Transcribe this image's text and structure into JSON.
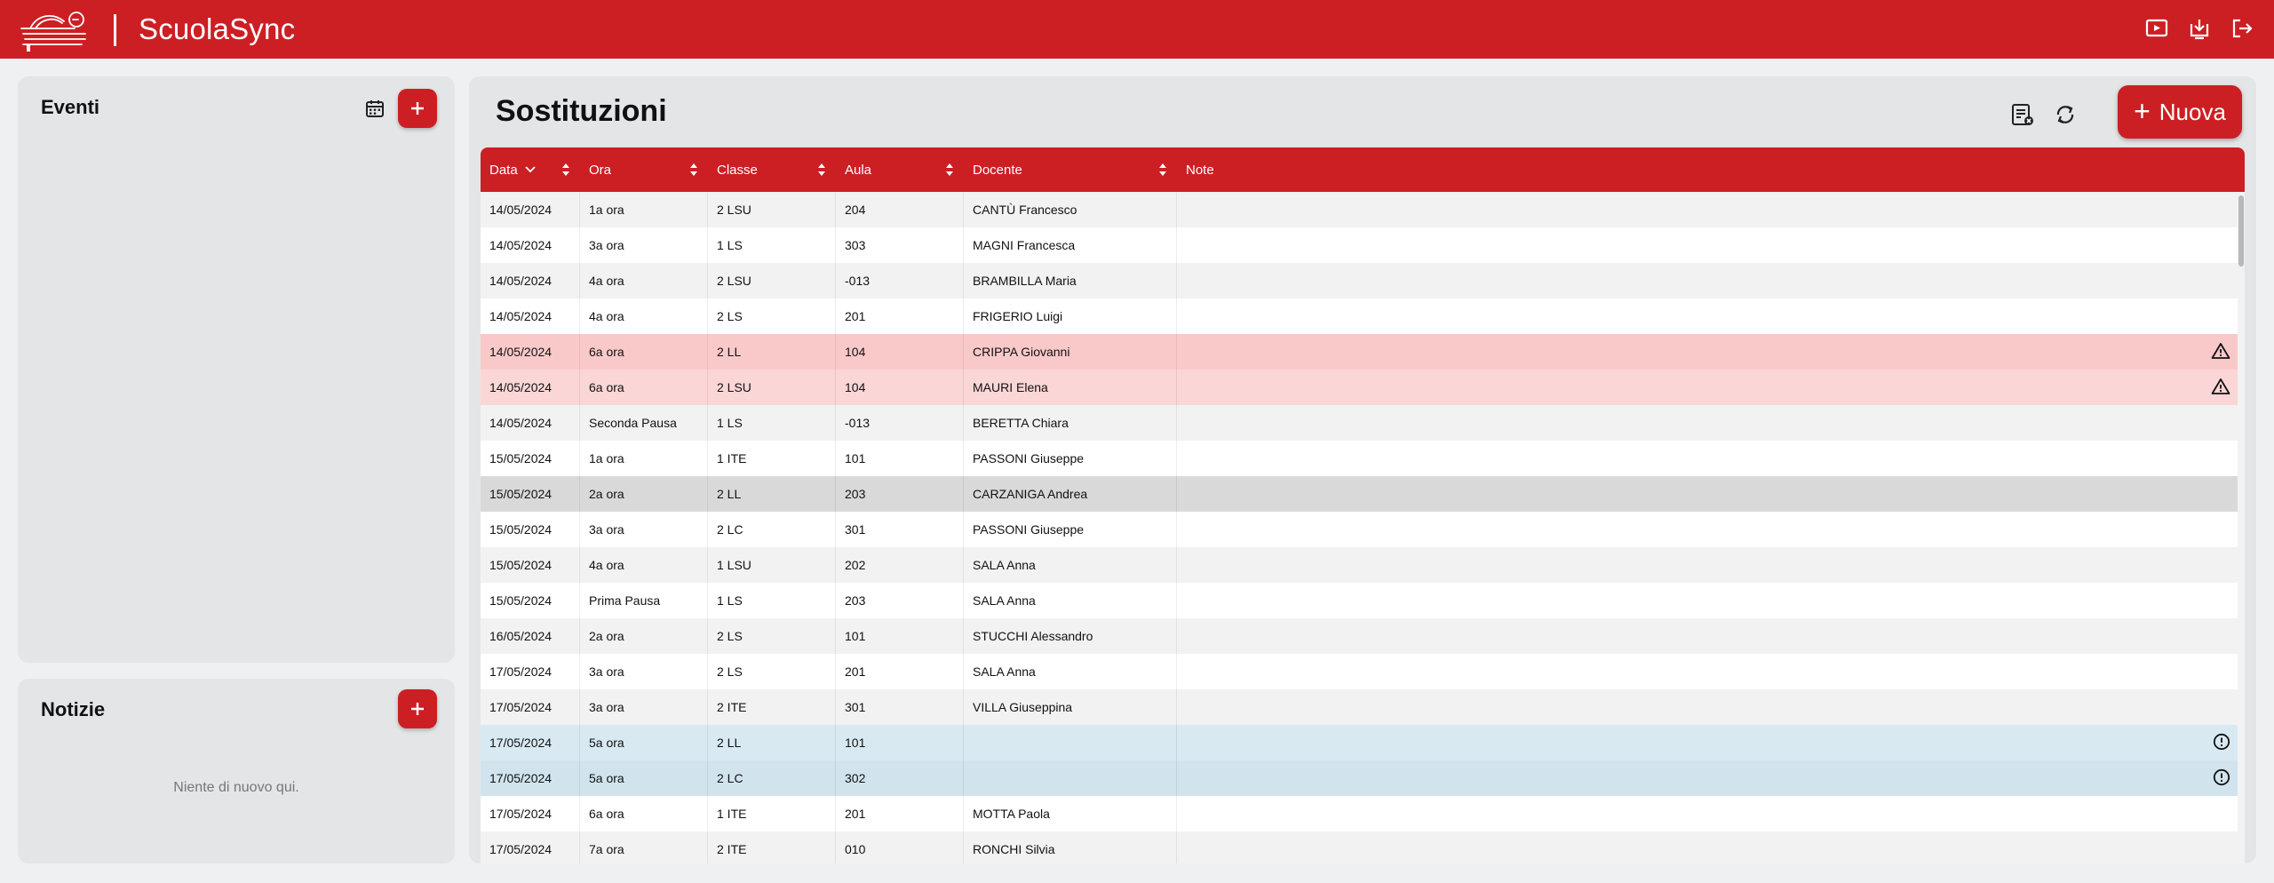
{
  "app": {
    "name": "ScuolaSync"
  },
  "header": {
    "icons": [
      "presentation-icon",
      "download-icon",
      "logout-icon"
    ]
  },
  "events": {
    "title": "Eventi",
    "add_label": "+"
  },
  "news": {
    "title": "Notizie",
    "add_label": "+",
    "empty_text": "Niente di nuovo qui."
  },
  "main": {
    "title": "Sostituzioni",
    "new_label": "Nuova",
    "new_plus": "+",
    "columns": [
      "Data",
      "Ora",
      "Classe",
      "Aula",
      "Docente",
      "Note"
    ],
    "rows": [
      {
        "date": "14/05/2024",
        "ora": "1a ora",
        "classe": "2 LSU",
        "aula": "204",
        "docente": "CANTÙ Francesco",
        "note": "",
        "status": "normal"
      },
      {
        "date": "14/05/2024",
        "ora": "3a ora",
        "classe": "1 LS",
        "aula": "303",
        "docente": "MAGNI Francesca",
        "note": "",
        "status": "normal"
      },
      {
        "date": "14/05/2024",
        "ora": "4a ora",
        "classe": "2 LSU",
        "aula": "-013",
        "docente": "BRAMBILLA Maria",
        "note": "",
        "status": "normal"
      },
      {
        "date": "14/05/2024",
        "ora": "4a ora",
        "classe": "2 LS",
        "aula": "201",
        "docente": "FRIGERIO Luigi",
        "note": "",
        "status": "normal"
      },
      {
        "date": "14/05/2024",
        "ora": "6a ora",
        "classe": "2 LL",
        "aula": "104",
        "docente": "CRIPPA Giovanni",
        "note": "",
        "status": "warning"
      },
      {
        "date": "14/05/2024",
        "ora": "6a ora",
        "classe": "2 LSU",
        "aula": "104",
        "docente": "MAURI Elena",
        "note": "",
        "status": "warning"
      },
      {
        "date": "14/05/2024",
        "ora": "Seconda Pausa",
        "classe": "1 LS",
        "aula": "-013",
        "docente": "BERETTA Chiara",
        "note": "",
        "status": "normal"
      },
      {
        "date": "15/05/2024",
        "ora": "1a ora",
        "classe": "1 ITE",
        "aula": "101",
        "docente": "PASSONI Giuseppe",
        "note": "",
        "status": "normal"
      },
      {
        "date": "15/05/2024",
        "ora": "2a ora",
        "classe": "2 LL",
        "aula": "203",
        "docente": "CARZANIGA Andrea",
        "note": "",
        "status": "selected"
      },
      {
        "date": "15/05/2024",
        "ora": "3a ora",
        "classe": "2 LC",
        "aula": "301",
        "docente": "PASSONI Giuseppe",
        "note": "",
        "status": "normal"
      },
      {
        "date": "15/05/2024",
        "ora": "4a ora",
        "classe": "1 LSU",
        "aula": "202",
        "docente": "SALA Anna",
        "note": "",
        "status": "normal"
      },
      {
        "date": "15/05/2024",
        "ora": "Prima Pausa",
        "classe": "1 LS",
        "aula": "203",
        "docente": "SALA Anna",
        "note": "",
        "status": "normal"
      },
      {
        "date": "16/05/2024",
        "ora": "2a ora",
        "classe": "2 LS",
        "aula": "101",
        "docente": "STUCCHI Alessandro",
        "note": "",
        "status": "normal"
      },
      {
        "date": "17/05/2024",
        "ora": "3a ora",
        "classe": "2 LS",
        "aula": "201",
        "docente": "SALA Anna",
        "note": "",
        "status": "normal"
      },
      {
        "date": "17/05/2024",
        "ora": "3a ora",
        "classe": "2 ITE",
        "aula": "301",
        "docente": "VILLA Giuseppina",
        "note": "",
        "status": "normal"
      },
      {
        "date": "17/05/2024",
        "ora": "5a ora",
        "classe": "2 LL",
        "aula": "101",
        "docente": "",
        "note": "",
        "status": "info"
      },
      {
        "date": "17/05/2024",
        "ora": "5a ora",
        "classe": "2 LC",
        "aula": "302",
        "docente": "",
        "note": "",
        "status": "info"
      },
      {
        "date": "17/05/2024",
        "ora": "6a ora",
        "classe": "1 ITE",
        "aula": "201",
        "docente": "MOTTA Paola",
        "note": "",
        "status": "normal"
      },
      {
        "date": "17/05/2024",
        "ora": "7a ora",
        "classe": "2 ITE",
        "aula": "010",
        "docente": "RONCHI Silvia",
        "note": "",
        "status": "normal"
      }
    ]
  },
  "colors": {
    "accent": "#cc1f24",
    "warning_row": "#f9c9ca",
    "info_row": "#d8e9f2",
    "selected_row": "#d9d9d9"
  }
}
